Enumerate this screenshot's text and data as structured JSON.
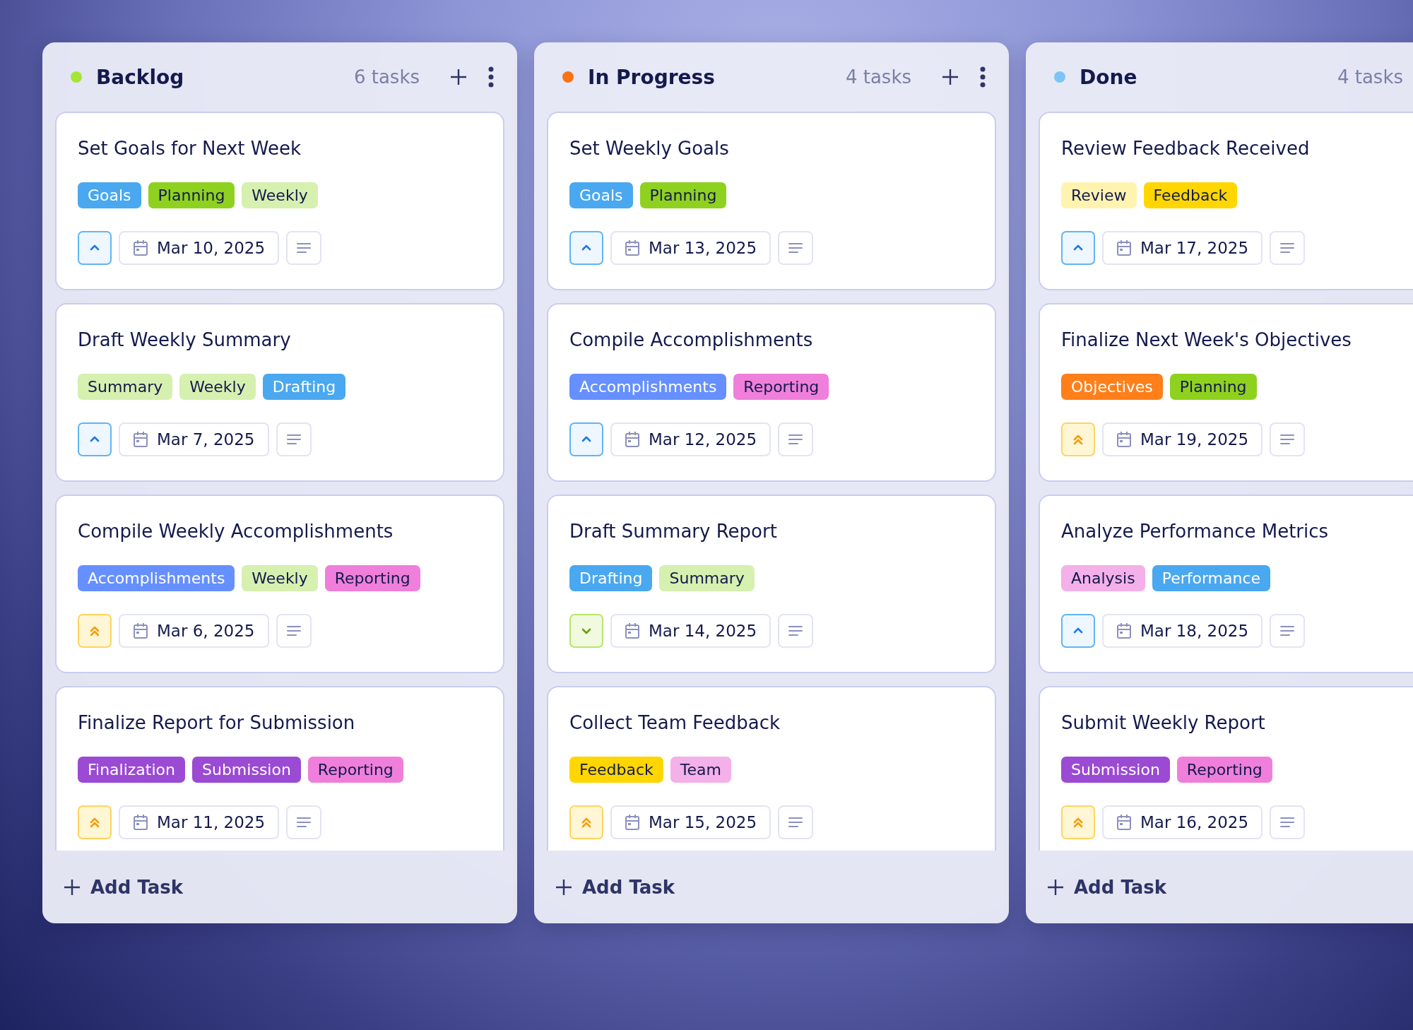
{
  "columns": [
    {
      "title": "Backlog",
      "color": "#a3e635",
      "count": "6 tasks",
      "add_task": "Add Task",
      "cards": [
        {
          "title": "Set Goals for Next Week",
          "kind": "medium",
          "date": "Mar 10, 2025",
          "tags": [
            {
              "label": "Goals",
              "color": "#4aa8f0"
            },
            {
              "label": "Planning",
              "color": "#8fd11f"
            },
            {
              "label": "Weekly",
              "color": "#d6f0b0"
            }
          ]
        },
        {
          "title": "Draft Weekly Summary",
          "kind": "medium",
          "date": "Mar 7, 2025",
          "tags": [
            {
              "label": "Summary",
              "color": "#d6f0b0"
            },
            {
              "label": "Weekly",
              "color": "#d6f0b0"
            },
            {
              "label": "Drafting",
              "color": "#4aa8f0"
            }
          ]
        },
        {
          "title": "Compile Weekly Accomplishments",
          "kind": "high",
          "date": "Mar 6, 2025",
          "tags": [
            {
              "label": "Accomplishments",
              "color": "#6690ff"
            },
            {
              "label": "Weekly",
              "color": "#d6f0b0"
            },
            {
              "label": "Reporting",
              "color": "#ef7fdb"
            }
          ]
        },
        {
          "title": "Finalize Report for Submission",
          "kind": "high",
          "date": "Mar 11, 2025",
          "tags": [
            {
              "label": "Finalization",
              "color": "#9b4ad4"
            },
            {
              "label": "Submission",
              "color": "#9b4ad4"
            },
            {
              "label": "Reporting",
              "color": "#ef7fdb"
            }
          ]
        }
      ]
    },
    {
      "title": "In Progress",
      "color": "#f97316",
      "count": "4 tasks",
      "add_task": "Add Task",
      "cards": [
        {
          "title": "Set Weekly Goals",
          "kind": "medium",
          "date": "Mar 13, 2025",
          "tags": [
            {
              "label": "Goals",
              "color": "#4aa8f0"
            },
            {
              "label": "Planning",
              "color": "#8fd11f"
            }
          ]
        },
        {
          "title": "Compile Accomplishments",
          "kind": "medium",
          "date": "Mar 12, 2025",
          "tags": [
            {
              "label": "Accomplishments",
              "color": "#6690ff"
            },
            {
              "label": "Reporting",
              "color": "#ef7fdb"
            }
          ]
        },
        {
          "title": "Draft Summary Report",
          "kind": "low",
          "date": "Mar 14, 2025",
          "tags": [
            {
              "label": "Drafting",
              "color": "#4aa8f0"
            },
            {
              "label": "Summary",
              "color": "#d6f0b0"
            }
          ]
        },
        {
          "title": "Collect Team Feedback",
          "kind": "high",
          "date": "Mar 15, 2025",
          "tags": [
            {
              "label": "Feedback",
              "color": "#ffd600"
            },
            {
              "label": "Team",
              "color": "#f4b0e8"
            }
          ]
        }
      ]
    },
    {
      "title": "Done",
      "color": "#7dc4f5",
      "count": "4 tasks",
      "add_task": "Add Task",
      "cards": [
        {
          "title": "Review Feedback Received",
          "kind": "medium",
          "date": "Mar 17, 2025",
          "tags": [
            {
              "label": "Review",
              "color": "#fff3b0"
            },
            {
              "label": "Feedback",
              "color": "#ffd600"
            }
          ]
        },
        {
          "title": "Finalize Next Week's Objectives",
          "kind": "high",
          "date": "Mar 19, 2025",
          "tags": [
            {
              "label": "Objectives",
              "color": "#ff7f1a"
            },
            {
              "label": "Planning",
              "color": "#8fd11f"
            }
          ]
        },
        {
          "title": "Analyze Performance Metrics",
          "kind": "medium",
          "date": "Mar 18, 2025",
          "tags": [
            {
              "label": "Analysis",
              "color": "#f4b0e8"
            },
            {
              "label": "Performance",
              "color": "#4aa8f0"
            }
          ]
        },
        {
          "title": "Submit Weekly Report",
          "kind": "high",
          "date": "Mar 16, 2025",
          "tags": [
            {
              "label": "Submission",
              "color": "#9b4ad4"
            },
            {
              "label": "Reporting",
              "color": "#ef7fdb"
            }
          ]
        }
      ]
    }
  ]
}
